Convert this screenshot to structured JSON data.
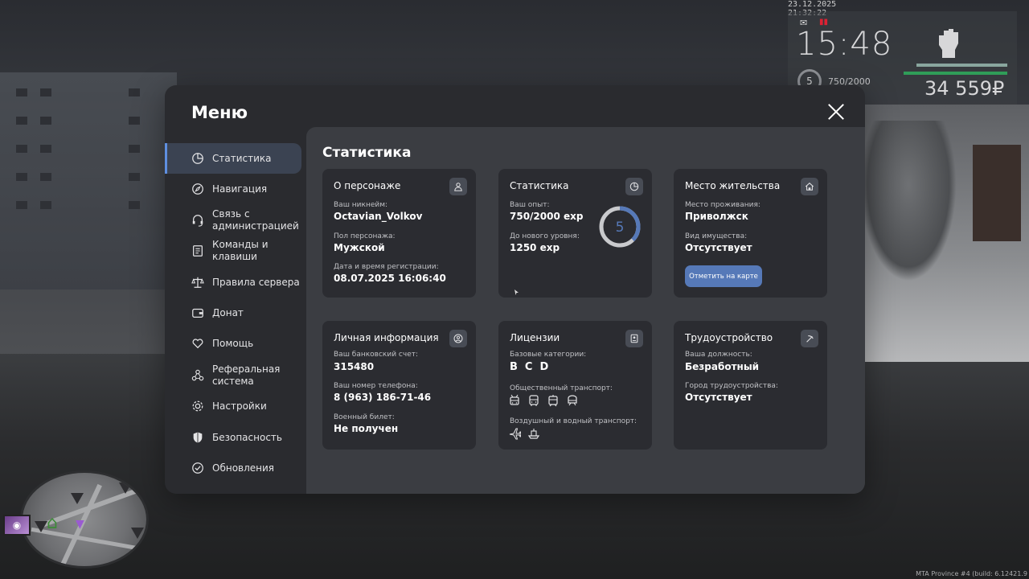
{
  "hud": {
    "datetime": "23.12.2025 21:32:22",
    "time": "15:48",
    "level": "5",
    "exp": "750/2000",
    "money": "34 559₽",
    "build_info": "MTA Province #4 (build: 6.12421.9"
  },
  "menu": {
    "title": "Меню",
    "sidebar": [
      {
        "label": "Статистика",
        "icon": "pie-chart-icon",
        "active": true
      },
      {
        "label": "Навигация",
        "icon": "compass-icon"
      },
      {
        "label": "Связь с администрацией",
        "icon": "headset-icon"
      },
      {
        "label": "Команды и клавиши",
        "icon": "document-icon"
      },
      {
        "label": "Правила сервера",
        "icon": "scales-icon"
      },
      {
        "label": "Донат",
        "icon": "wallet-icon"
      },
      {
        "label": "Помощь",
        "icon": "heart-hands-icon"
      },
      {
        "label": "Реферальная система",
        "icon": "network-icon"
      },
      {
        "label": "Настройки",
        "icon": "gear-icon"
      },
      {
        "label": "Безопасность",
        "icon": "shield-icon"
      },
      {
        "label": "Обновления",
        "icon": "check-circle-icon"
      }
    ]
  },
  "content": {
    "title": "Статистика",
    "character": {
      "title": "О персонаже",
      "nickname_label": "Ваш никнейм:",
      "nickname": "Octavian_Volkov",
      "gender_label": "Пол персонажа:",
      "gender": "Мужской",
      "reg_label": "Дата и время регистрации:",
      "reg": "08.07.2025 16:06:40"
    },
    "stats": {
      "title": "Статистика",
      "exp_label": "Ваш опыт:",
      "exp": "750/2000 exp",
      "next_label": "До нового уровня:",
      "next": "1250 exp",
      "level": "5",
      "progress": 0.375
    },
    "residence": {
      "title": "Место жительства",
      "place_label": "Место проживания:",
      "place": "Приволжск",
      "property_label": "Вид имущества:",
      "property": "Отсутствует",
      "map_button": "Отметить на карте"
    },
    "personal": {
      "title": "Личная информация",
      "bank_label": "Ваш банковский счет:",
      "bank": "315480",
      "phone_label": "Ваш номер телефона:",
      "phone": "8 (963) 186-71-46",
      "military_label": "Военный билет:",
      "military": "Не получен"
    },
    "licenses": {
      "title": "Лицензии",
      "base_label": "Базовые категории:",
      "categories": [
        "B",
        "C",
        "D"
      ],
      "public_label": "Общественный транспорт:",
      "air_label": "Воздушный и водный транспорт:"
    },
    "employment": {
      "title": "Трудоустройство",
      "position_label": "Ваша должность:",
      "position": "Безработный",
      "city_label": "Город трудоустройства:",
      "city": "Отсутствует"
    }
  },
  "colors": {
    "accent": "#5679b8",
    "active_bar": "#5f8fe0",
    "card_bg": "#2b2c31",
    "content_bg": "#3b3d42"
  }
}
